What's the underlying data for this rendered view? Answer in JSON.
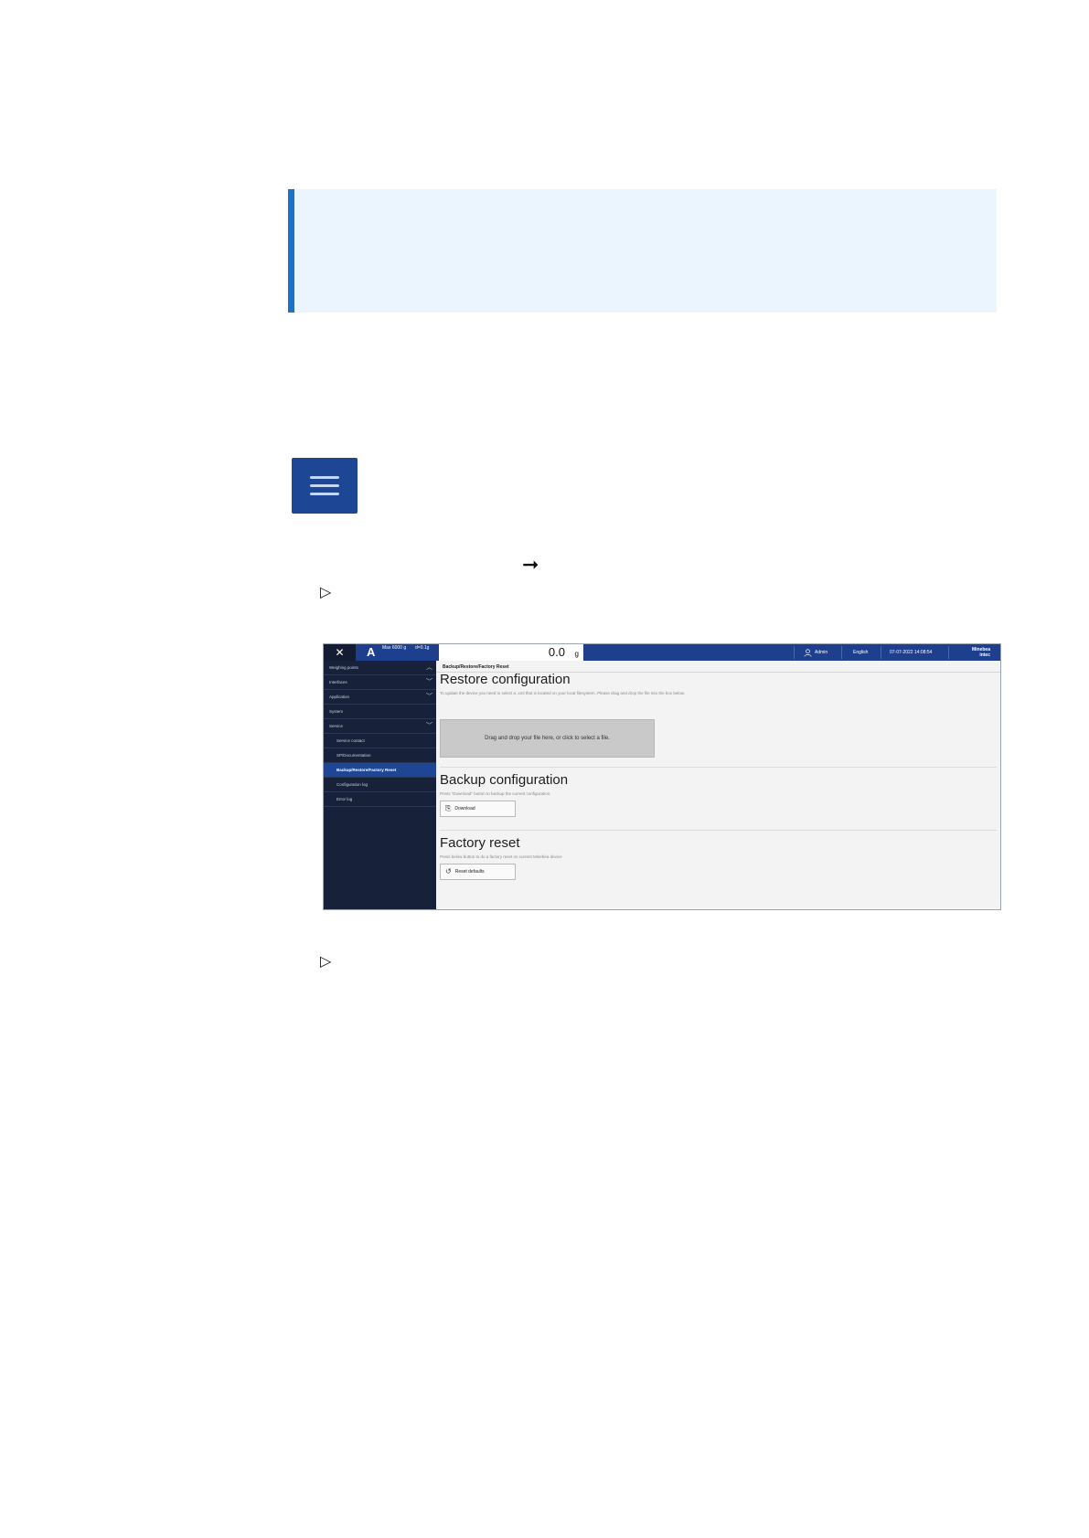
{
  "screenshot": {
    "topbar": {
      "close_icon": "close-icon",
      "scale_letter": "A",
      "max_label": "Max 6000 g",
      "d_label": "d=0.1g",
      "weight_value": "0.0",
      "weight_unit": "g",
      "user": "Admin",
      "language": "English",
      "datetime": "07-07-2022 14:08:54",
      "logo_line1": "Minebea",
      "logo_line2": "intec"
    },
    "sidebar": [
      {
        "label": "Weighing points",
        "chevron": "up"
      },
      {
        "label": "Interfaces",
        "chevron": "down"
      },
      {
        "label": "Application",
        "chevron": "down"
      },
      {
        "label": "System",
        "chevron": ""
      },
      {
        "label": "Service",
        "chevron": "down"
      },
      {
        "label": "Service contact",
        "chevron": ""
      },
      {
        "label": "SP/Documentation",
        "chevron": ""
      },
      {
        "label": "Backup/Restore/Factory Reset",
        "chevron": ""
      },
      {
        "label": "Configuration log",
        "chevron": ""
      },
      {
        "label": "Error log",
        "chevron": ""
      }
    ],
    "breadcrumb": "Backup/Restore/Factory Reset",
    "restore": {
      "title": "Restore configuration",
      "description": "To update the device you need to select a .xml that is located on your local filesystem. Please drag and drop the file into the box below.",
      "dropzone": "Drag and drop your file here, or click to select a file."
    },
    "backup": {
      "title": "Backup configuration",
      "description": "Press \"Download\" button to backup the current configuration.",
      "button": "Download"
    },
    "reset": {
      "title": "Factory reset",
      "description": "Press below button to do a factory reset on current Minebea device",
      "button": "Reset defaults"
    }
  }
}
